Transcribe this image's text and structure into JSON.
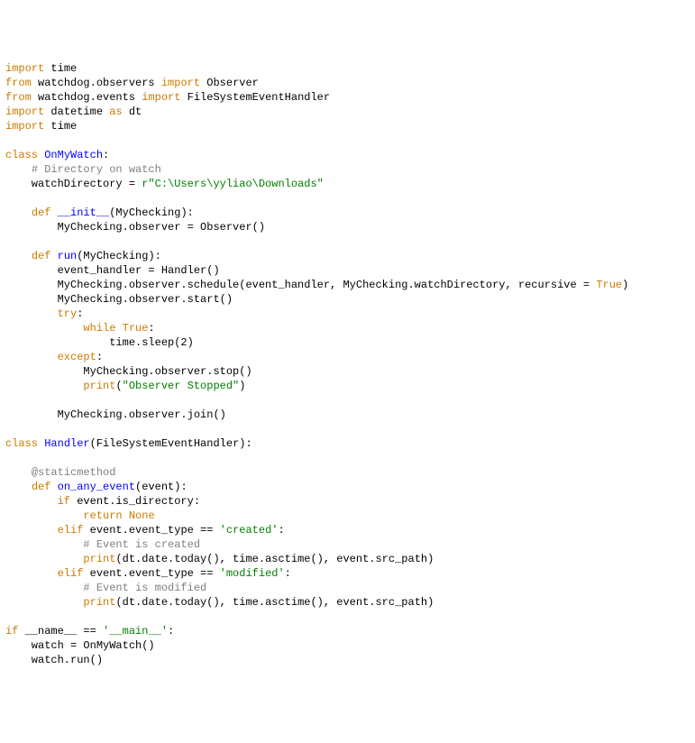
{
  "tokens": [
    [
      [
        "import",
        "kw"
      ],
      [
        " time",
        ""
      ]
    ],
    [
      [
        "from",
        "kw"
      ],
      [
        " watchdog.observers ",
        ""
      ],
      [
        "import",
        "kw"
      ],
      [
        " Observer",
        ""
      ]
    ],
    [
      [
        "from",
        "kw"
      ],
      [
        " watchdog.events ",
        ""
      ],
      [
        "import",
        "kw"
      ],
      [
        " FileSystemEventHandler",
        ""
      ]
    ],
    [
      [
        "import",
        "kw"
      ],
      [
        " datetime ",
        ""
      ],
      [
        "as",
        "kw"
      ],
      [
        " dt",
        ""
      ]
    ],
    [
      [
        "import",
        "kw"
      ],
      [
        " time",
        ""
      ]
    ],
    [
      [
        "",
        ""
      ]
    ],
    [
      [
        "class",
        "kw"
      ],
      [
        " ",
        ""
      ],
      [
        "OnMyWatch",
        "cls"
      ],
      [
        ":",
        ""
      ]
    ],
    [
      [
        "    ",
        ""
      ],
      [
        "# Directory on watch",
        "cmt"
      ]
    ],
    [
      [
        "    watchDirectory = ",
        ""
      ],
      [
        "r\"C:\\Users\\yyliao\\Downloads\"",
        "str"
      ]
    ],
    [
      [
        "",
        ""
      ]
    ],
    [
      [
        "    ",
        ""
      ],
      [
        "def",
        "kw"
      ],
      [
        " ",
        ""
      ],
      [
        "__init__",
        "fn"
      ],
      [
        "(MyChecking):",
        ""
      ]
    ],
    [
      [
        "        MyChecking.observer = Observer()",
        ""
      ]
    ],
    [
      [
        "",
        ""
      ]
    ],
    [
      [
        "    ",
        ""
      ],
      [
        "def",
        "kw"
      ],
      [
        " ",
        ""
      ],
      [
        "run",
        "fn"
      ],
      [
        "(MyChecking):",
        ""
      ]
    ],
    [
      [
        "        event_handler = Handler()",
        ""
      ]
    ],
    [
      [
        "        MyChecking.observer.schedule(event_handler, MyChecking.watchDirectory, recursive = ",
        ""
      ],
      [
        "True",
        "bool"
      ],
      [
        ")",
        ""
      ]
    ],
    [
      [
        "        MyChecking.observer.start()",
        ""
      ]
    ],
    [
      [
        "        ",
        ""
      ],
      [
        "try",
        "kw"
      ],
      [
        ":",
        ""
      ]
    ],
    [
      [
        "            ",
        ""
      ],
      [
        "while",
        "kw"
      ],
      [
        " ",
        ""
      ],
      [
        "True",
        "bool"
      ],
      [
        ":",
        ""
      ]
    ],
    [
      [
        "                time.sleep(2)",
        ""
      ]
    ],
    [
      [
        "        ",
        ""
      ],
      [
        "except",
        "kw"
      ],
      [
        ":",
        ""
      ]
    ],
    [
      [
        "            MyChecking.observer.stop()",
        ""
      ]
    ],
    [
      [
        "            ",
        ""
      ],
      [
        "print",
        "kw"
      ],
      [
        "(",
        ""
      ],
      [
        "\"Observer Stopped\"",
        "str"
      ],
      [
        ")",
        ""
      ]
    ],
    [
      [
        "",
        ""
      ]
    ],
    [
      [
        "        MyChecking.observer.join()",
        ""
      ]
    ],
    [
      [
        "",
        ""
      ]
    ],
    [
      [
        "class",
        "kw"
      ],
      [
        " ",
        ""
      ],
      [
        "Handler",
        "cls"
      ],
      [
        "(FileSystemEventHandler):",
        ""
      ]
    ],
    [
      [
        "",
        ""
      ]
    ],
    [
      [
        "    ",
        ""
      ],
      [
        "@staticmethod",
        "dec"
      ]
    ],
    [
      [
        "    ",
        ""
      ],
      [
        "def",
        "kw"
      ],
      [
        " ",
        ""
      ],
      [
        "on_any_event",
        "fn"
      ],
      [
        "(event):",
        ""
      ]
    ],
    [
      [
        "        ",
        ""
      ],
      [
        "if",
        "kw"
      ],
      [
        " event.is_directory:",
        ""
      ]
    ],
    [
      [
        "            ",
        ""
      ],
      [
        "return",
        "kw"
      ],
      [
        " ",
        ""
      ],
      [
        "None",
        "bool"
      ]
    ],
    [
      [
        "        ",
        ""
      ],
      [
        "elif",
        "kw"
      ],
      [
        " event.event_type == ",
        ""
      ],
      [
        "'created'",
        "str"
      ],
      [
        ":",
        ""
      ]
    ],
    [
      [
        "            ",
        ""
      ],
      [
        "# Event is created",
        "cmt"
      ]
    ],
    [
      [
        "            ",
        ""
      ],
      [
        "print",
        "kw"
      ],
      [
        "(dt.date.today(), time.asctime(), event.src_path)",
        ""
      ]
    ],
    [
      [
        "        ",
        ""
      ],
      [
        "elif",
        "kw"
      ],
      [
        " event.event_type == ",
        ""
      ],
      [
        "'modified'",
        "str"
      ],
      [
        ":",
        ""
      ]
    ],
    [
      [
        "            ",
        ""
      ],
      [
        "# Event is modified",
        "cmt"
      ]
    ],
    [
      [
        "            ",
        ""
      ],
      [
        "print",
        "kw"
      ],
      [
        "(dt.date.today(), time.asctime(), event.src_path)",
        ""
      ]
    ],
    [
      [
        "",
        ""
      ]
    ],
    [
      [
        "if",
        "kw"
      ],
      [
        " __name__ == ",
        ""
      ],
      [
        "'__main__'",
        "str"
      ],
      [
        ":",
        ""
      ]
    ],
    [
      [
        "    watch = OnMyWatch()",
        ""
      ]
    ],
    [
      [
        "    watch.run()",
        ""
      ]
    ]
  ]
}
